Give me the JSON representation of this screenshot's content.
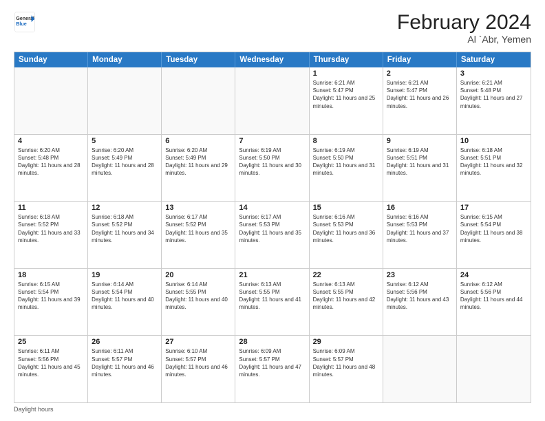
{
  "header": {
    "logo_general": "General",
    "logo_blue": "Blue",
    "title": "February 2024",
    "subtitle": "Al `Abr, Yemen"
  },
  "days_of_week": [
    "Sunday",
    "Monday",
    "Tuesday",
    "Wednesday",
    "Thursday",
    "Friday",
    "Saturday"
  ],
  "weeks": [
    [
      {
        "day": "",
        "sunrise": "",
        "sunset": "",
        "daylight": "",
        "empty": true
      },
      {
        "day": "",
        "sunrise": "",
        "sunset": "",
        "daylight": "",
        "empty": true
      },
      {
        "day": "",
        "sunrise": "",
        "sunset": "",
        "daylight": "",
        "empty": true
      },
      {
        "day": "",
        "sunrise": "",
        "sunset": "",
        "daylight": "",
        "empty": true
      },
      {
        "day": "1",
        "sunrise": "Sunrise: 6:21 AM",
        "sunset": "Sunset: 5:47 PM",
        "daylight": "Daylight: 11 hours and 25 minutes.",
        "empty": false
      },
      {
        "day": "2",
        "sunrise": "Sunrise: 6:21 AM",
        "sunset": "Sunset: 5:47 PM",
        "daylight": "Daylight: 11 hours and 26 minutes.",
        "empty": false
      },
      {
        "day": "3",
        "sunrise": "Sunrise: 6:21 AM",
        "sunset": "Sunset: 5:48 PM",
        "daylight": "Daylight: 11 hours and 27 minutes.",
        "empty": false
      }
    ],
    [
      {
        "day": "4",
        "sunrise": "Sunrise: 6:20 AM",
        "sunset": "Sunset: 5:48 PM",
        "daylight": "Daylight: 11 hours and 28 minutes.",
        "empty": false
      },
      {
        "day": "5",
        "sunrise": "Sunrise: 6:20 AM",
        "sunset": "Sunset: 5:49 PM",
        "daylight": "Daylight: 11 hours and 28 minutes.",
        "empty": false
      },
      {
        "day": "6",
        "sunrise": "Sunrise: 6:20 AM",
        "sunset": "Sunset: 5:49 PM",
        "daylight": "Daylight: 11 hours and 29 minutes.",
        "empty": false
      },
      {
        "day": "7",
        "sunrise": "Sunrise: 6:19 AM",
        "sunset": "Sunset: 5:50 PM",
        "daylight": "Daylight: 11 hours and 30 minutes.",
        "empty": false
      },
      {
        "day": "8",
        "sunrise": "Sunrise: 6:19 AM",
        "sunset": "Sunset: 5:50 PM",
        "daylight": "Daylight: 11 hours and 31 minutes.",
        "empty": false
      },
      {
        "day": "9",
        "sunrise": "Sunrise: 6:19 AM",
        "sunset": "Sunset: 5:51 PM",
        "daylight": "Daylight: 11 hours and 31 minutes.",
        "empty": false
      },
      {
        "day": "10",
        "sunrise": "Sunrise: 6:18 AM",
        "sunset": "Sunset: 5:51 PM",
        "daylight": "Daylight: 11 hours and 32 minutes.",
        "empty": false
      }
    ],
    [
      {
        "day": "11",
        "sunrise": "Sunrise: 6:18 AM",
        "sunset": "Sunset: 5:52 PM",
        "daylight": "Daylight: 11 hours and 33 minutes.",
        "empty": false
      },
      {
        "day": "12",
        "sunrise": "Sunrise: 6:18 AM",
        "sunset": "Sunset: 5:52 PM",
        "daylight": "Daylight: 11 hours and 34 minutes.",
        "empty": false
      },
      {
        "day": "13",
        "sunrise": "Sunrise: 6:17 AM",
        "sunset": "Sunset: 5:52 PM",
        "daylight": "Daylight: 11 hours and 35 minutes.",
        "empty": false
      },
      {
        "day": "14",
        "sunrise": "Sunrise: 6:17 AM",
        "sunset": "Sunset: 5:53 PM",
        "daylight": "Daylight: 11 hours and 35 minutes.",
        "empty": false
      },
      {
        "day": "15",
        "sunrise": "Sunrise: 6:16 AM",
        "sunset": "Sunset: 5:53 PM",
        "daylight": "Daylight: 11 hours and 36 minutes.",
        "empty": false
      },
      {
        "day": "16",
        "sunrise": "Sunrise: 6:16 AM",
        "sunset": "Sunset: 5:53 PM",
        "daylight": "Daylight: 11 hours and 37 minutes.",
        "empty": false
      },
      {
        "day": "17",
        "sunrise": "Sunrise: 6:15 AM",
        "sunset": "Sunset: 5:54 PM",
        "daylight": "Daylight: 11 hours and 38 minutes.",
        "empty": false
      }
    ],
    [
      {
        "day": "18",
        "sunrise": "Sunrise: 6:15 AM",
        "sunset": "Sunset: 5:54 PM",
        "daylight": "Daylight: 11 hours and 39 minutes.",
        "empty": false
      },
      {
        "day": "19",
        "sunrise": "Sunrise: 6:14 AM",
        "sunset": "Sunset: 5:54 PM",
        "daylight": "Daylight: 11 hours and 40 minutes.",
        "empty": false
      },
      {
        "day": "20",
        "sunrise": "Sunrise: 6:14 AM",
        "sunset": "Sunset: 5:55 PM",
        "daylight": "Daylight: 11 hours and 40 minutes.",
        "empty": false
      },
      {
        "day": "21",
        "sunrise": "Sunrise: 6:13 AM",
        "sunset": "Sunset: 5:55 PM",
        "daylight": "Daylight: 11 hours and 41 minutes.",
        "empty": false
      },
      {
        "day": "22",
        "sunrise": "Sunrise: 6:13 AM",
        "sunset": "Sunset: 5:55 PM",
        "daylight": "Daylight: 11 hours and 42 minutes.",
        "empty": false
      },
      {
        "day": "23",
        "sunrise": "Sunrise: 6:12 AM",
        "sunset": "Sunset: 5:56 PM",
        "daylight": "Daylight: 11 hours and 43 minutes.",
        "empty": false
      },
      {
        "day": "24",
        "sunrise": "Sunrise: 6:12 AM",
        "sunset": "Sunset: 5:56 PM",
        "daylight": "Daylight: 11 hours and 44 minutes.",
        "empty": false
      }
    ],
    [
      {
        "day": "25",
        "sunrise": "Sunrise: 6:11 AM",
        "sunset": "Sunset: 5:56 PM",
        "daylight": "Daylight: 11 hours and 45 minutes.",
        "empty": false
      },
      {
        "day": "26",
        "sunrise": "Sunrise: 6:11 AM",
        "sunset": "Sunset: 5:57 PM",
        "daylight": "Daylight: 11 hours and 46 minutes.",
        "empty": false
      },
      {
        "day": "27",
        "sunrise": "Sunrise: 6:10 AM",
        "sunset": "Sunset: 5:57 PM",
        "daylight": "Daylight: 11 hours and 46 minutes.",
        "empty": false
      },
      {
        "day": "28",
        "sunrise": "Sunrise: 6:09 AM",
        "sunset": "Sunset: 5:57 PM",
        "daylight": "Daylight: 11 hours and 47 minutes.",
        "empty": false
      },
      {
        "day": "29",
        "sunrise": "Sunrise: 6:09 AM",
        "sunset": "Sunset: 5:57 PM",
        "daylight": "Daylight: 11 hours and 48 minutes.",
        "empty": false
      },
      {
        "day": "",
        "sunrise": "",
        "sunset": "",
        "daylight": "",
        "empty": true
      },
      {
        "day": "",
        "sunrise": "",
        "sunset": "",
        "daylight": "",
        "empty": true
      }
    ]
  ],
  "footer": {
    "text": "Daylight hours"
  }
}
